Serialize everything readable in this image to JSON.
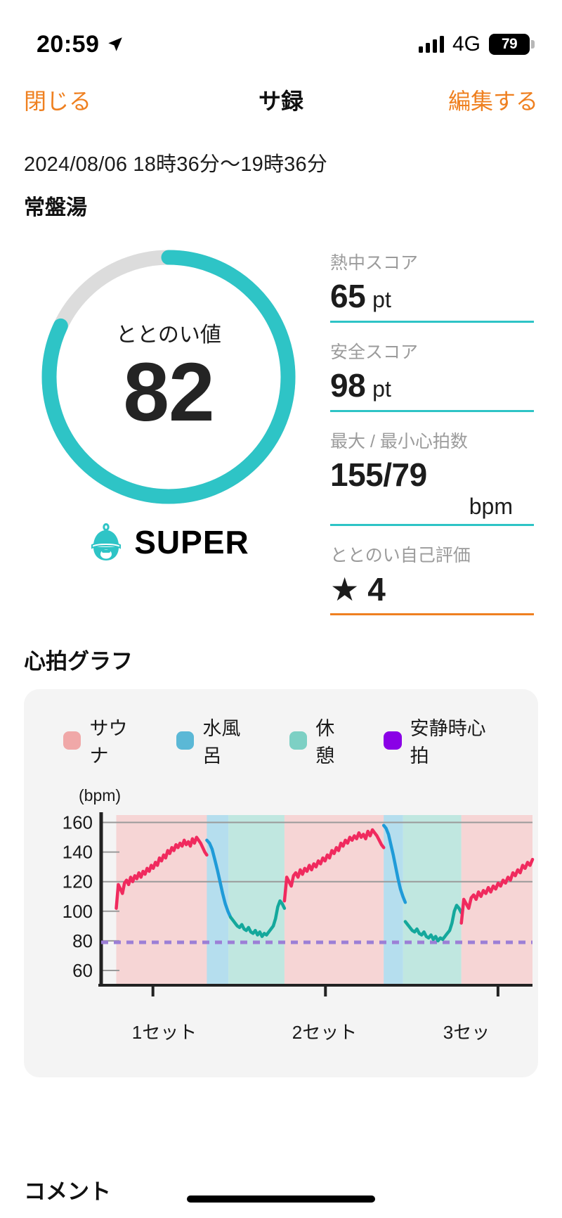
{
  "status_bar": {
    "time": "20:59",
    "location_icon": "location-arrow-icon",
    "signal_icon": "cellular-bars-icon",
    "network": "4G",
    "battery_level": "79"
  },
  "nav": {
    "close_label": "閉じる",
    "title": "サ録",
    "edit_label": "編集する",
    "accent_color": "#ef8020"
  },
  "record": {
    "date_range": "2024/08/06 18時36分〜19時36分",
    "venue": "常盤湯"
  },
  "gauge": {
    "label": "ととのい値",
    "value": "82",
    "percent": 82,
    "track_color": "#dcdcdc",
    "arc_color": "#2ec4c6",
    "rank_label": "SUPER",
    "rank_icon": "sauna-hat-mascot-icon",
    "rank_color": "#2ec4c6"
  },
  "stats": [
    {
      "label": "熱中スコア",
      "value": "65",
      "unit": "pt",
      "rule_color": "#2ec4c6"
    },
    {
      "label": "安全スコア",
      "value": "98",
      "unit": "pt",
      "rule_color": "#2ec4c6"
    },
    {
      "label": "最大 / 最小心拍数",
      "value": "155/79",
      "unit": "bpm",
      "rule_color": "#2ec4c6"
    },
    {
      "label": "ととのい自己評価",
      "value": "4",
      "unit": "",
      "star": "★",
      "rule_color": "#ef8020"
    }
  ],
  "chart_section": {
    "title": "心拍グラフ"
  },
  "chart_data": {
    "type": "line",
    "title": "心拍グラフ",
    "ylabel": "(bpm)",
    "xlabel": "",
    "ylim": [
      50,
      165
    ],
    "yticks": [
      160,
      140,
      120,
      100,
      80,
      60
    ],
    "gridlines": [
      160,
      120
    ],
    "grid": true,
    "legend_position": "top",
    "legend": [
      {
        "name": "サウナ",
        "color": "#f0a8a8"
      },
      {
        "name": "水風呂",
        "color": "#5bb8d6"
      },
      {
        "name": "休憩",
        "color": "#7dd0c4"
      },
      {
        "name": "安静時心拍",
        "color": "#8a00e6"
      }
    ],
    "xticks": [
      "1セット",
      "2セット",
      "3セッ"
    ],
    "xtick_positions": [
      0.12,
      0.52,
      0.92
    ],
    "resting_hr": 79,
    "phases": [
      {
        "type": "サウナ",
        "start": 0.035,
        "end": 0.245,
        "color": "#f6cfcf"
      },
      {
        "type": "水風呂",
        "start": 0.245,
        "end": 0.295,
        "color": "#a9d9ec"
      },
      {
        "type": "休憩",
        "start": 0.295,
        "end": 0.425,
        "color": "#b6e4dc"
      },
      {
        "type": "サウナ",
        "start": 0.425,
        "end": 0.655,
        "color": "#f6cfcf"
      },
      {
        "type": "水風呂",
        "start": 0.655,
        "end": 0.7,
        "color": "#a9d9ec"
      },
      {
        "type": "休憩",
        "start": 0.7,
        "end": 0.835,
        "color": "#b6e4dc"
      },
      {
        "type": "サウナ",
        "start": 0.835,
        "end": 1.0,
        "color": "#f6cfcf"
      }
    ],
    "series": [
      {
        "name": "サウナ心拍",
        "color": "#f02a5e",
        "values": [
          102,
          118,
          115,
          112,
          119,
          121,
          118,
          123,
          120,
          124,
          122,
          126,
          123,
          127,
          125,
          129,
          127,
          131,
          129,
          133,
          131,
          136,
          134,
          138,
          136,
          141,
          139,
          143,
          141,
          145,
          143,
          146,
          144,
          148,
          145,
          147,
          144,
          149,
          146,
          150,
          148,
          146,
          143,
          140,
          138
        ]
      },
      {
        "name": "水風呂心拍",
        "color": "#1f9bd8",
        "values": [
          148,
          146,
          142,
          135,
          128,
          120,
          112,
          105,
          100,
          96
        ]
      },
      {
        "name": "休憩心拍",
        "color": "#14a89c",
        "values": [
          96,
          94,
          92,
          90,
          89,
          91,
          88,
          87,
          89,
          86,
          85,
          87,
          84,
          86,
          83,
          85,
          84,
          86,
          88,
          90,
          95,
          103,
          107,
          105,
          102
        ]
      }
    ],
    "sets": [
      {
        "set": 1,
        "sauna": {
          "start_bpm": 102,
          "peak_bpm": 150
        },
        "cold": {
          "peak_bpm": 148,
          "min_bpm": 96
        },
        "rest": {
          "min_bpm": 83,
          "end_bpm": 107
        }
      },
      {
        "set": 2,
        "sauna": {
          "start_bpm": 105,
          "peak_bpm": 155
        },
        "cold": {
          "peak_bpm": 153,
          "min_bpm": 110
        },
        "rest": {
          "min_bpm": 80,
          "end_bpm": 108
        }
      },
      {
        "set": 3,
        "sauna": {
          "start_bpm": 92,
          "peak_bpm": 137
        }
      }
    ]
  },
  "bottom": {
    "comment_title": "コメント"
  }
}
